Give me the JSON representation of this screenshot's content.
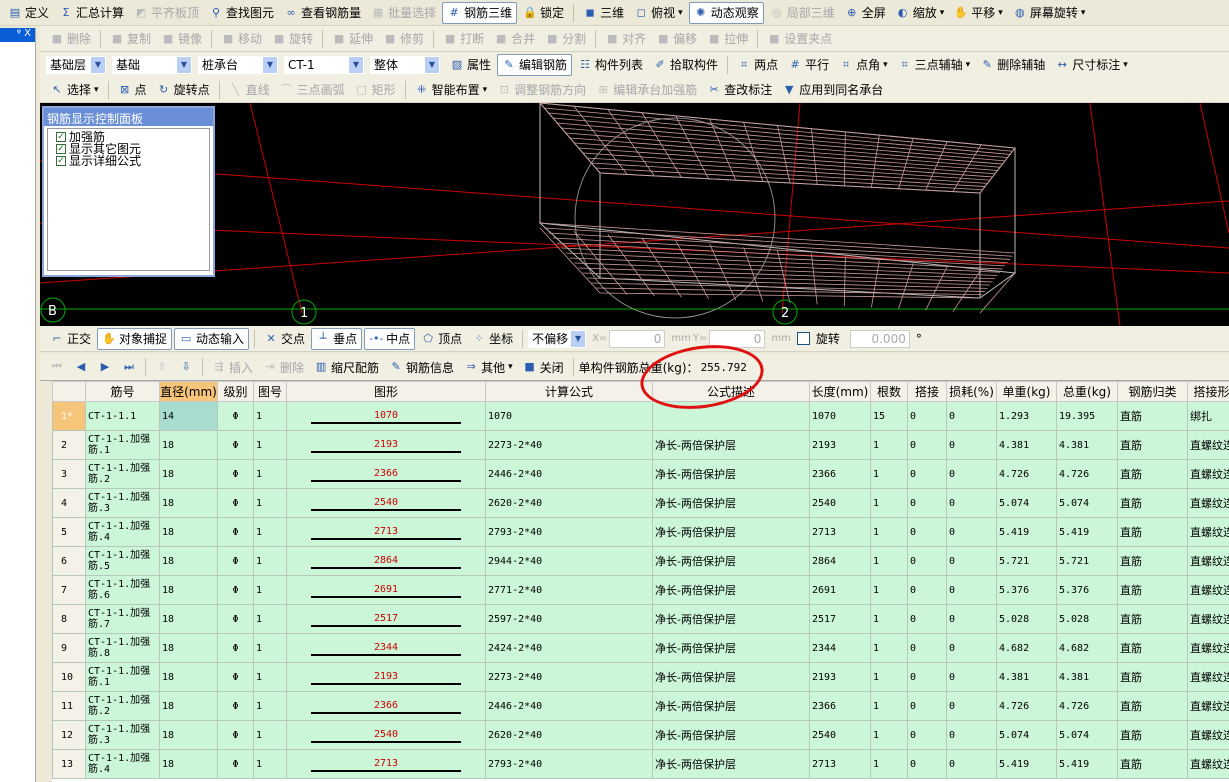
{
  "toolbar1": [
    "定义",
    "汇总计算",
    "平齐板顶",
    "查找图元",
    "查看钢筋量",
    "批量选择",
    "钢筋三维",
    "锁定"
  ],
  "toolbar1r": [
    "三维",
    "俯视",
    "动态观察",
    "局部三维",
    "全屏",
    "缩放",
    "平移",
    "屏幕旋转"
  ],
  "toolbar2": [
    "删除",
    "复制",
    "镜像",
    "移动",
    "旋转",
    "延伸",
    "修剪",
    "打断",
    "合并",
    "分割",
    "对齐",
    "偏移",
    "拉伸",
    "设置夹点"
  ],
  "selects": [
    "基础层",
    "基础",
    "桩承台",
    "CT-1",
    "整体"
  ],
  "toolbar3": [
    "属性",
    "编辑钢筋",
    "构件列表",
    "拾取构件",
    "两点",
    "平行",
    "点角",
    "三点辅轴",
    "删除辅轴",
    "尺寸标注"
  ],
  "toolbar4": [
    "选择",
    "点",
    "旋转点",
    "直线",
    "三点画弧",
    "矩形",
    "智能布置",
    "调整钢筋方向",
    "编辑承台加强筋",
    "查改标注",
    "应用到同名承台"
  ],
  "panel": {
    "title": "钢筋显示控制面板",
    "items": [
      "加强筋",
      "显示其它图元",
      "显示详细公式"
    ]
  },
  "axes": [
    "B",
    "1",
    "2"
  ],
  "snapbar": {
    "items": [
      "正交",
      "对象捕捉",
      "动态输入",
      "交点",
      "垂点",
      "中点",
      "顶点",
      "坐标"
    ],
    "offset": "不偏移",
    "x_label": "X=",
    "x": "0",
    "y_label": "Y=",
    "y": "0",
    "unit": "mm",
    "rotate": "旋转",
    "angle": "0.000",
    "deg": "°"
  },
  "gridbar": {
    "items": [
      "插入",
      "删除",
      "缩尺配筋",
      "钢筋信息",
      "其他",
      "关闭"
    ],
    "total_label": "单构件钢筋总重(kg)：",
    "total": "255.792"
  },
  "left_title": "ᵠ X",
  "columns": [
    "",
    "筋号",
    "直径(mm)",
    "级别",
    "图号",
    "图形",
    "计算公式",
    "公式描述",
    "长度(mm)",
    "根数",
    "搭接",
    "损耗(%)",
    "单重(kg)",
    "总重(kg)",
    "钢筋归类",
    "搭接形式"
  ],
  "rows": [
    [
      "1*",
      "CT-1-1.1",
      "14",
      "Φ",
      "1",
      "1070",
      "1070",
      "",
      "1070",
      "15",
      "0",
      "0",
      "1.293",
      "19.395",
      "直筋",
      "绑扎"
    ],
    [
      "2",
      "CT-1-1.加强筋.1",
      "18",
      "Φ",
      "1",
      "2193",
      "2273-2*40",
      "净长-两倍保护层",
      "2193",
      "1",
      "0",
      "0",
      "4.381",
      "4.381",
      "直筋",
      "直螺纹连接"
    ],
    [
      "3",
      "CT-1-1.加强筋.2",
      "18",
      "Φ",
      "1",
      "2366",
      "2446-2*40",
      "净长-两倍保护层",
      "2366",
      "1",
      "0",
      "0",
      "4.726",
      "4.726",
      "直筋",
      "直螺纹连接"
    ],
    [
      "4",
      "CT-1-1.加强筋.3",
      "18",
      "Φ",
      "1",
      "2540",
      "2620-2*40",
      "净长-两倍保护层",
      "2540",
      "1",
      "0",
      "0",
      "5.074",
      "5.074",
      "直筋",
      "直螺纹连接"
    ],
    [
      "5",
      "CT-1-1.加强筋.4",
      "18",
      "Φ",
      "1",
      "2713",
      "2793-2*40",
      "净长-两倍保护层",
      "2713",
      "1",
      "0",
      "0",
      "5.419",
      "5.419",
      "直筋",
      "直螺纹连接"
    ],
    [
      "6",
      "CT-1-1.加强筋.5",
      "18",
      "Φ",
      "1",
      "2864",
      "2944-2*40",
      "净长-两倍保护层",
      "2864",
      "1",
      "0",
      "0",
      "5.721",
      "5.721",
      "直筋",
      "直螺纹连接"
    ],
    [
      "7",
      "CT-1-1.加强筋.6",
      "18",
      "Φ",
      "1",
      "2691",
      "2771-2*40",
      "净长-两倍保护层",
      "2691",
      "1",
      "0",
      "0",
      "5.376",
      "5.376",
      "直筋",
      "直螺纹连接"
    ],
    [
      "8",
      "CT-1-1.加强筋.7",
      "18",
      "Φ",
      "1",
      "2517",
      "2597-2*40",
      "净长-两倍保护层",
      "2517",
      "1",
      "0",
      "0",
      "5.028",
      "5.028",
      "直筋",
      "直螺纹连接"
    ],
    [
      "9",
      "CT-1-1.加强筋.8",
      "18",
      "Φ",
      "1",
      "2344",
      "2424-2*40",
      "净长-两倍保护层",
      "2344",
      "1",
      "0",
      "0",
      "4.682",
      "4.682",
      "直筋",
      "直螺纹连接"
    ],
    [
      "10",
      "CT-1-1.加强筋.1",
      "18",
      "Φ",
      "1",
      "2193",
      "2273-2*40",
      "净长-两倍保护层",
      "2193",
      "1",
      "0",
      "0",
      "4.381",
      "4.381",
      "直筋",
      "直螺纹连接"
    ],
    [
      "11",
      "CT-1-1.加强筋.2",
      "18",
      "Φ",
      "1",
      "2366",
      "2446-2*40",
      "净长-两倍保护层",
      "2366",
      "1",
      "0",
      "0",
      "4.726",
      "4.726",
      "直筋",
      "直螺纹连接"
    ],
    [
      "12",
      "CT-1-1.加强筋.3",
      "18",
      "Φ",
      "1",
      "2540",
      "2620-2*40",
      "净长-两倍保护层",
      "2540",
      "1",
      "0",
      "0",
      "5.074",
      "5.074",
      "直筋",
      "直螺纹连接"
    ],
    [
      "13",
      "CT-1-1.加强筋.4",
      "18",
      "Φ",
      "1",
      "2713",
      "2793-2*40",
      "净长-两倍保护层",
      "2713",
      "1",
      "0",
      "0",
      "5.419",
      "5.419",
      "直筋",
      "直螺纹连接"
    ]
  ]
}
